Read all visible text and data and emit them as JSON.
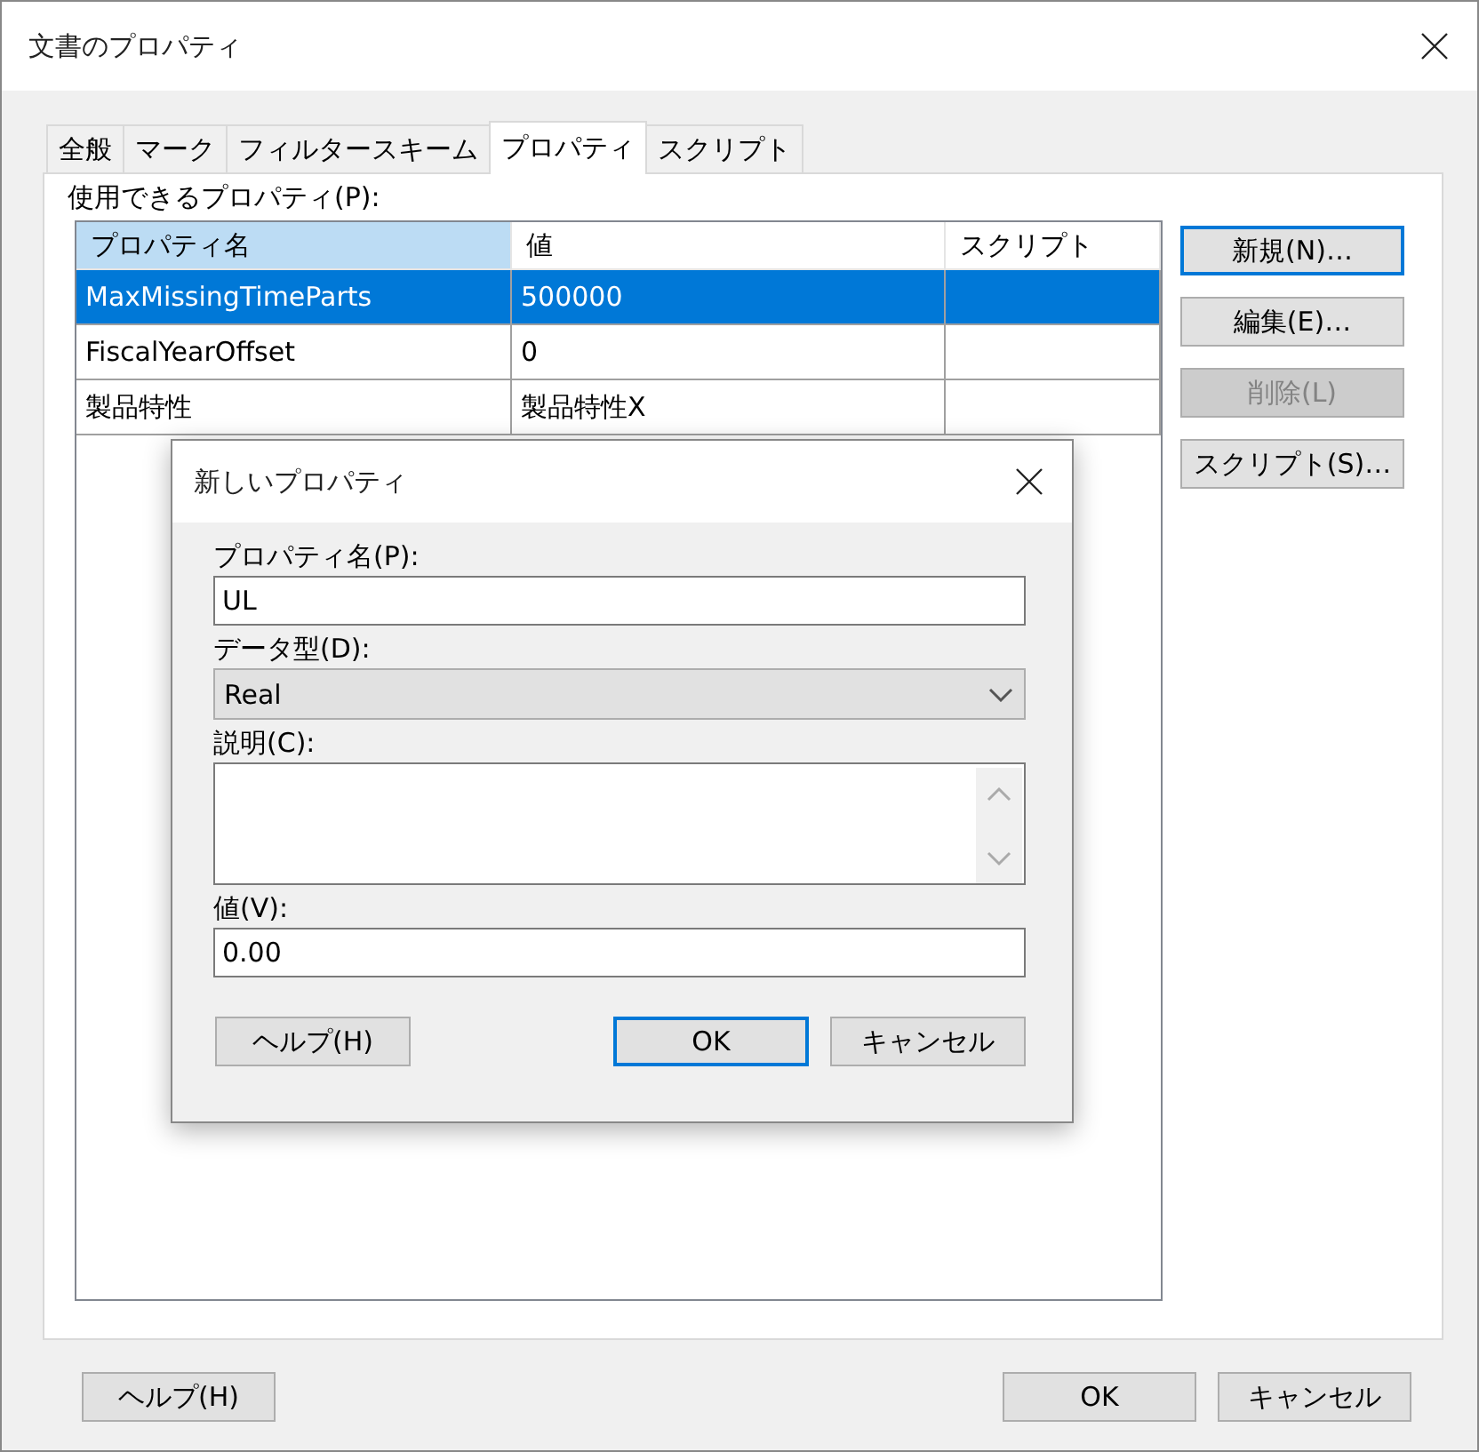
{
  "window": {
    "title": "文書のプロパティ"
  },
  "tabs": [
    {
      "label": "全般",
      "selected": false
    },
    {
      "label": "マーク",
      "selected": false
    },
    {
      "label": "フィルタースキーム",
      "selected": false
    },
    {
      "label": "プロパティ",
      "selected": true
    },
    {
      "label": "スクリプト",
      "selected": false
    }
  ],
  "properties_label": "使用できるプロパティ(P):",
  "table": {
    "columns": [
      {
        "label": "プロパティ名",
        "selected": true
      },
      {
        "label": "値",
        "selected": false
      },
      {
        "label": "スクリプト",
        "selected": false
      }
    ],
    "rows": [
      {
        "cells": [
          "MaxMissingTimeParts",
          "500000",
          ""
        ],
        "selected": true
      },
      {
        "cells": [
          "FiscalYearOffset",
          "0",
          ""
        ],
        "selected": false
      },
      {
        "cells": [
          "製品特性",
          "製品特性X",
          ""
        ],
        "selected": false
      }
    ]
  },
  "side_buttons": [
    {
      "label": "新規(N)…",
      "focused": true,
      "disabled": false
    },
    {
      "label": "編集(E)…",
      "focused": false,
      "disabled": false
    },
    {
      "label": "削除(L)",
      "focused": false,
      "disabled": true
    },
    {
      "label": "スクリプト(S)…",
      "focused": false,
      "disabled": false
    }
  ],
  "footer_buttons": [
    {
      "label": "ヘルプ(H)",
      "focused": false
    },
    {
      "label": "OK",
      "focused": false
    },
    {
      "label": "キャンセル",
      "focused": false
    }
  ],
  "dialog": {
    "title": "新しいプロパティ",
    "fields": [
      {
        "kind": "text",
        "label": "プロパティ名(P):",
        "value": "UL"
      },
      {
        "kind": "combo",
        "label": "データ型(D):",
        "value": "Real"
      },
      {
        "kind": "memo",
        "label": "説明(C):"
      },
      {
        "kind": "text",
        "label": "値(V):",
        "value": "0.00"
      }
    ],
    "buttons": [
      {
        "label": "ヘルプ(H)",
        "focused": false
      },
      {
        "label": "OK",
        "focused": true
      },
      {
        "label": "キャンセル",
        "focused": false
      }
    ]
  }
}
